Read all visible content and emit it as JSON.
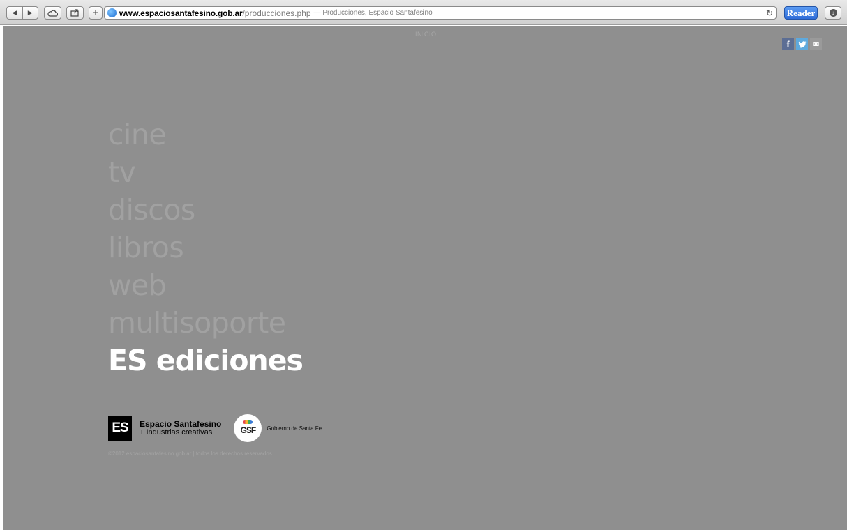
{
  "browser": {
    "back_icon": "◀",
    "forward_icon": "▶",
    "add_icon": "+",
    "url_host": "www.espaciosantafesino.gob.ar",
    "url_path": "/producciones.php",
    "page_title": "— Producciones, Espacio Santafesino",
    "reload_icon": "↻",
    "reader_label": "Reader"
  },
  "header": {
    "menu_label": "INICIO"
  },
  "social": {
    "facebook": "f",
    "twitter": "t",
    "email": "✉"
  },
  "nav": {
    "items": [
      {
        "label": "cine"
      },
      {
        "label": "tv"
      },
      {
        "label": "discos"
      },
      {
        "label": "libros"
      },
      {
        "label": "web"
      },
      {
        "label": "multisoporte"
      },
      {
        "label": "ES ediciones"
      }
    ],
    "active": "ES ediciones"
  },
  "footer": {
    "es_mark": "ES",
    "es_name": "Espacio Santafesino",
    "es_sub": "+ Industrias creativas",
    "gsf_mark": "GSF",
    "gsf_name": "Gobierno de Santa Fe",
    "copyright": "©2012 espaciosantafesino.gob.ar | todos los derechos reservados"
  },
  "colors": {
    "page_bg": "#8f8f8f",
    "nav_inactive": "#a1a1a1",
    "nav_active": "#ffffff",
    "reader_button": "#3a78e0"
  }
}
